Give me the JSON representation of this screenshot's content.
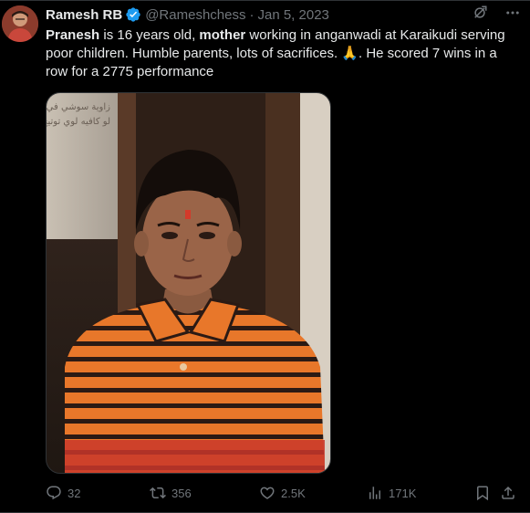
{
  "tweet": {
    "author_name": "Ramesh RB",
    "handle": "@Rameshchess",
    "separator": "·",
    "date": "Jan 5, 2023",
    "text": {
      "p1_bold": "Pranesh",
      "p2": " is 16 years old, ",
      "p3_bold": "mother",
      "p4": " working in anganwadi at Karaikudi serving poor children. Humble parents, lots of sacrifices. ",
      "emoji": "🙏",
      "p5": ". He scored 7 wins in a row for a 2775 performance"
    },
    "media": {
      "sign_text_line1": "زاوية سوشي في مصر",
      "sign_text_line2": "لو كافيه لوي توتيخ"
    },
    "stats": {
      "replies": "32",
      "retweets": "356",
      "likes": "2.5K",
      "views": "171K"
    },
    "icons": {
      "verified": "verified-badge-icon",
      "grok": "grok-icon",
      "more": "more-icon",
      "reply": "reply-icon",
      "retweet": "retweet-icon",
      "like": "like-icon",
      "views": "views-icon",
      "bookmark": "bookmark-icon",
      "share": "share-icon"
    },
    "colors": {
      "background": "#000000",
      "text": "#e7e9ea",
      "secondary": "#71767b",
      "verified": "#1d9bf0",
      "shirt_orange": "#e8772a"
    }
  }
}
